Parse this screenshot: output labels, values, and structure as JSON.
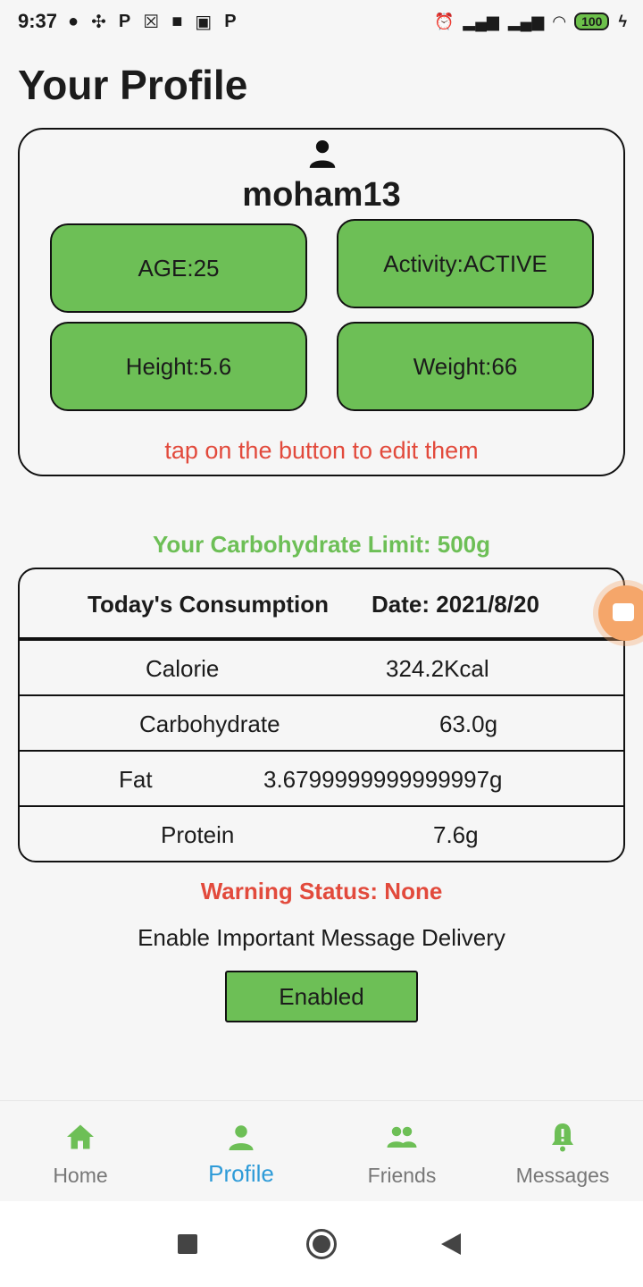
{
  "status_bar": {
    "time": "9:37",
    "left_icons": [
      "reddit-icon",
      "fan-icon",
      "p-icon",
      "p-icon",
      "box-icon",
      "video-icon",
      "image-icon",
      "p-icon"
    ],
    "right_icons": [
      "alarm-icon",
      "signal-icon",
      "signal-icon",
      "wifi-icon"
    ],
    "battery": "100"
  },
  "page": {
    "title": "Your Profile"
  },
  "profile": {
    "username": "moham13",
    "age": "AGE:25",
    "activity": "Activity:ACTIVE",
    "height": "Height:5.6",
    "weight": "Weight:66",
    "edit_hint": "tap on the button to edit them"
  },
  "carb_limit": "Your Carbohydrate Limit: 500g",
  "consumption": {
    "title": "Today's Consumption",
    "date": "Date: 2021/8/20",
    "rows": [
      {
        "label": "Calorie",
        "value": "324.2Kcal"
      },
      {
        "label": "Carbohydrate",
        "value": "63.0g"
      },
      {
        "label": "Fat",
        "value": "3.6799999999999997g"
      },
      {
        "label": "Protein",
        "value": "7.6g"
      }
    ]
  },
  "warning_status": "Warning Status: None",
  "delivery": {
    "label": "Enable Important Message Delivery",
    "button": "Enabled"
  },
  "bottom_nav": {
    "items": [
      {
        "label": "Home",
        "icon": "home-icon"
      },
      {
        "label": "Profile",
        "icon": "person-icon"
      },
      {
        "label": "Friends",
        "icon": "people-icon"
      },
      {
        "label": "Messages",
        "icon": "bell-icon"
      }
    ],
    "active": "Profile"
  },
  "colors": {
    "accent_green": "#6dbf56",
    "warning_red": "#e24a3c",
    "active_blue": "#2e9bd8"
  }
}
